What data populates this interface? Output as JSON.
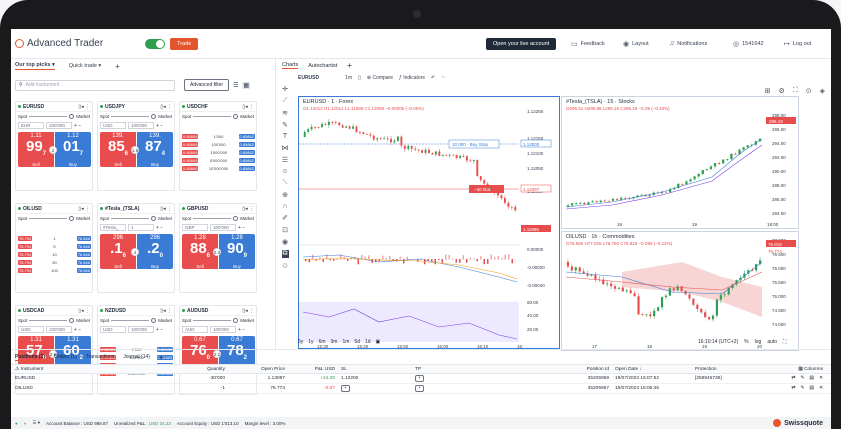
{
  "app": {
    "title": "Advanced Trader",
    "trade_label": "Trade"
  },
  "topnav": {
    "open_live": "Open your live account",
    "feedback": "Feedback",
    "layout": "Layout",
    "notifications": "Notifications",
    "user_id": "1541642",
    "logout": "Log out"
  },
  "left_tabs": {
    "our_top_picks": "Our top picks",
    "quick_trade": "Quick trade",
    "add": "+"
  },
  "search": {
    "placeholder": "Add instrument",
    "advanced_filter": "Advanced filter"
  },
  "cards": [
    {
      "symbol": "EURUSD",
      "spot": "Spot",
      "market": "Market",
      "ccy": "EUR",
      "qty": "100'000",
      "sell_small": "1.11",
      "sell_big": "99",
      "sell_sup": "7",
      "buy_small": "1.12",
      "buy_big": "01",
      "buy_sup": "7",
      "spread": "2",
      "sell_label": "Sell",
      "buy_label": "Buy"
    },
    {
      "symbol": "USDJPY",
      "spot": "Spot",
      "market": "Market",
      "ccy": "USD",
      "qty": "100'000",
      "sell_small": "139.",
      "sell_big": "85",
      "sell_sup": "6",
      "buy_small": "139.",
      "buy_big": "87",
      "buy_sup": "4",
      "spread": "1.8",
      "sell_label": "Sell",
      "buy_label": "Buy"
    },
    {
      "symbol": "USDCHF",
      "spot": "Spot",
      "market": "Market",
      "ladder": [
        {
          "sell": "0.85806",
          "qty": "1'000",
          "buy": "0.85862"
        },
        {
          "sell": "0.85806",
          "qty": "100'000",
          "buy": "0.85862"
        },
        {
          "sell": "0.85806",
          "qty": "1'000'000",
          "buy": "0.85862"
        },
        {
          "sell": "0.85806",
          "qty": "5'000'000",
          "buy": "0.85862"
        },
        {
          "sell": "0.85806",
          "qty": "10'000'000",
          "buy": "0.85862"
        }
      ]
    },
    {
      "symbol": "OILUSD",
      "spot": "Spot",
      "market": "Market",
      "ladder": [
        {
          "sell": "76.794",
          "qty": "1",
          "buy": "76.846"
        },
        {
          "sell": "76.794",
          "qty": "5",
          "buy": "76.846"
        },
        {
          "sell": "76.794",
          "qty": "10",
          "buy": "76.846"
        },
        {
          "sell": "76.794",
          "qty": "50",
          "buy": "76.846"
        },
        {
          "sell": "76.794",
          "qty": "100",
          "buy": "76.846"
        }
      ]
    },
    {
      "symbol": "#Tesla_(TSLA)",
      "spot": "Spot",
      "market": "Market",
      "ccy": "#Tesla_",
      "qty": "1",
      "sell_small": "296",
      "sell_big": ".1",
      "sell_sup": "6",
      "buy_small": "296",
      "buy_big": ".2",
      "buy_sup": "0",
      "spread": "4",
      "sell_label": "Sell",
      "buy_label": "Buy"
    },
    {
      "symbol": "GBPUSD",
      "spot": "Spot",
      "market": "Market",
      "ccy": "GBP",
      "qty": "100'000",
      "sell_small": "1.28",
      "sell_big": "88",
      "sell_sup": "6",
      "buy_small": "1.28",
      "buy_big": "90",
      "buy_sup": "9",
      "spread": "2.3",
      "sell_label": "Sell",
      "buy_label": "Buy"
    },
    {
      "symbol": "USDCAD",
      "spot": "Spot",
      "market": "Market",
      "ccy": "USD",
      "qty": "100'000",
      "sell_small": "1.31",
      "sell_big": "57",
      "sell_sup": "6",
      "buy_small": "1.31",
      "buy_big": "60",
      "buy_sup": "2",
      "spread": "2.6",
      "sell_label": "Sell",
      "buy_label": "Buy"
    },
    {
      "symbol": "NZDUSD",
      "spot": "Spot",
      "market": "Market",
      "ccy": "USD",
      "qty": "100'000",
      "ladder": [
        {
          "sell": "0.62451",
          "qty": "1'000",
          "buy": "0.62483"
        },
        {
          "sell": "0.62451",
          "qty": "100'000",
          "buy": "0.62483"
        },
        {
          "sell": "0.62451",
          "qty": "1'000'000",
          "buy": "0.62483"
        },
        {
          "sell": "0.62451",
          "qty": "5'000'000",
          "buy": "0.62483"
        }
      ]
    },
    {
      "symbol": "AUDUSD",
      "spot": "Spot",
      "market": "Market",
      "ccy": "AUD",
      "qty": "100'000",
      "sell_small": "0.67",
      "sell_big": "76",
      "sell_sup": "0",
      "buy_small": "0.67",
      "buy_big": "78",
      "buy_sup": "2",
      "spread": "2.2",
      "sell_label": "Sell",
      "buy_label": "Buy"
    }
  ],
  "chart_tabs": {
    "charts": "Charts",
    "autochartist": "Autochartist"
  },
  "chart_toolbar": {
    "symbol": "EURUSD",
    "interval": "1m",
    "compare": "Compare",
    "indicators": "Indicators"
  },
  "panels": {
    "eurusd": {
      "title": "EURUSD · 1 · Forex",
      "ohlc": "O1.12012 H1.12012 L1.11996 C1.12008 −0.00005 (−0.00%)",
      "order_label": "10 000 · Buy Stop",
      "order_price": "1.12000",
      "order2_label": "−30 000",
      "order2_price": "1.12097",
      "last_price": "1.11996",
      "yticks": [
        "1.12250",
        "1.12150",
        "1.12100",
        "1.12050",
        "1.11950"
      ],
      "osc_ticks": [
        "0.00000",
        "-0.00020",
        "-0.00040"
      ],
      "rsi_ticks": [
        "60.00",
        "40.00",
        "20.00"
      ],
      "xticks": [
        "15:30",
        "15:40",
        "15:50",
        "16:00",
        "16:10",
        "16:"
      ]
    },
    "tesla": {
      "title": "#Tesla_(TSLA) · 15 · Stocks",
      "ohlc": "O296.51 H296.88 L295.16 C296.19 −0.29 (−0.10%)",
      "last_price": "296.19",
      "yticks": [
        "298.00",
        "296.00",
        "294.00",
        "292.00",
        "290.00",
        "288.00",
        "286.00",
        "284.00"
      ],
      "xticks": [
        "18",
        "19",
        "18:00"
      ]
    },
    "oilusd": {
      "title": "OILUSD · 1h · Commodities",
      "ohlc": "O76.966 H77.025 L76.760 C76.815 −0.095 (−0.12%)",
      "last_price": "76.815",
      "ask_price": "76.774",
      "yticks": [
        "77.000",
        "76.500",
        "76.000",
        "75.500",
        "75.000",
        "74.500",
        "74.000"
      ],
      "xticks": [
        "17",
        "18",
        "19",
        "20"
      ]
    }
  },
  "range_buttons": [
    "5y",
    "1y",
    "6m",
    "3m",
    "1m",
    "5d",
    "1d"
  ],
  "chart_time": "16:10:14 (UTC+2)",
  "chart_scale": [
    "%",
    "log",
    "auto"
  ],
  "bottom_tabs": [
    "Positions (2)",
    "Orders (1)",
    "Transactions",
    "Journal (14)",
    "+"
  ],
  "table": {
    "headers": [
      "Instrument",
      "Quantity",
      "Open Price",
      "P&L USD",
      "SL",
      "TP",
      "Position Id",
      "Open Date",
      "Protection",
      "Columns"
    ],
    "rows": [
      {
        "instrument": "EURUSD",
        "quantity": "-30'000",
        "open_price": "1.13097",
        "pnl": "+24.30",
        "sl": "1.12200",
        "tp": "+",
        "position_id": "35205959",
        "open_date": "19/07/2023 16:07:52",
        "protection": "[258945739]"
      },
      {
        "instrument": "OILUSD",
        "quantity": "-1",
        "open_price": "76.774",
        "pnl": "-0.07",
        "sl": "+",
        "tp": "+",
        "position_id": "35205957",
        "open_date": "19/07/2023 16:06:46",
        "protection": ""
      }
    ]
  },
  "status": {
    "account_balance": "Account Balance : USD 988.87",
    "unrealized_label": "Unrealized P&L :",
    "unrealized_value": "USD 24.23",
    "equity": "Account Equity : USD 1'013.10",
    "margin": "Margin level : 3.00%",
    "brand": "Swissquote"
  },
  "colors": {
    "accent": "#e4572e",
    "sell": "#e94c4c",
    "buy": "#3a7bd5",
    "up": "#2e9e4f"
  }
}
